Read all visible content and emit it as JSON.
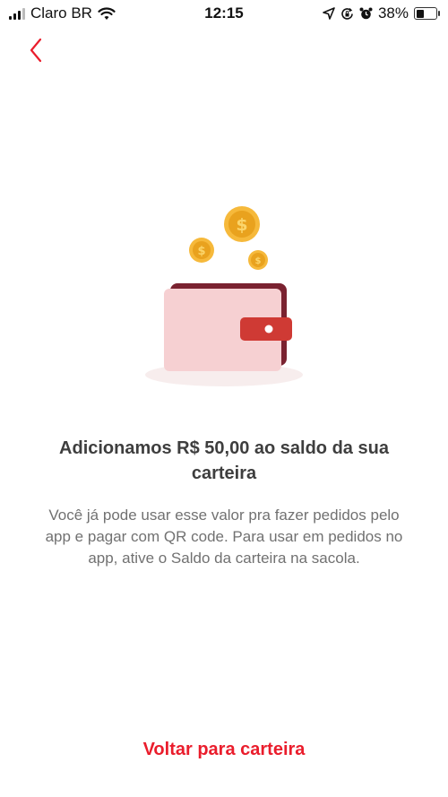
{
  "status_bar": {
    "carrier": "Claro BR",
    "time": "12:15",
    "battery": "38%",
    "icons": [
      "signal-icon",
      "wifi-icon",
      "location-icon",
      "screen-lock-icon",
      "alarm-icon",
      "battery-icon"
    ]
  },
  "header": {
    "back_icon": "chevron-left-icon"
  },
  "content": {
    "title": "Adicionamos R$ 50,00 ao saldo da sua carteira",
    "description": "Você já pode usar esse valor pra fazer pedidos pelo app e pagar com QR code. Para usar em pedidos no app, ative o Saldo da carteira na sacola."
  },
  "actions": {
    "back_to_wallet": "Voltar para carteira"
  },
  "colors": {
    "accent": "#ea1d2c",
    "wallet": "#f6d0d2",
    "coin": "#f0b429"
  }
}
